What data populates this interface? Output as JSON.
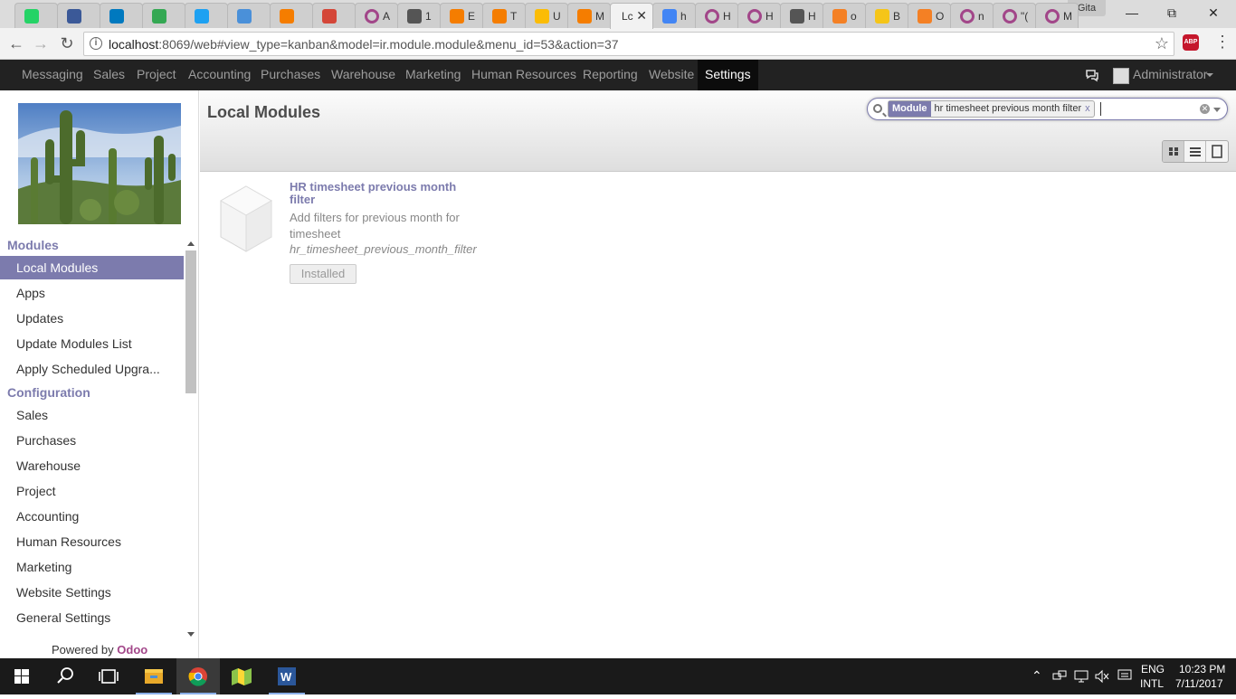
{
  "browser": {
    "tabs": [
      {
        "title": "",
        "icon": "whatsapp-icon",
        "color": "#25d366"
      },
      {
        "title": "",
        "icon": "facebook-icon",
        "color": "#3b5998"
      },
      {
        "title": "",
        "icon": "trello-icon",
        "color": "#0079bf"
      },
      {
        "title": "",
        "icon": "maps-icon",
        "color": "#34a853"
      },
      {
        "title": "",
        "icon": "twitter-icon",
        "color": "#1da1f2"
      },
      {
        "title": "",
        "icon": "stack-icon",
        "color": "#4a90d9"
      },
      {
        "title": "",
        "icon": "blogger-icon",
        "color": "#f57d00"
      },
      {
        "title": "",
        "icon": "gmail-icon",
        "color": "#d44638"
      },
      {
        "title": "A",
        "icon": "odoo-icon",
        "color": "#a24689"
      },
      {
        "title": "1",
        "icon": "hash-icon",
        "color": "#555555"
      },
      {
        "title": "E",
        "icon": "blogger-icon",
        "color": "#f57d00"
      },
      {
        "title": "T",
        "icon": "blogger-icon",
        "color": "#f57d00"
      },
      {
        "title": "U",
        "icon": "drive-icon",
        "color": "#fbbc05"
      },
      {
        "title": "M",
        "icon": "blogger-icon",
        "color": "#f57d00"
      },
      {
        "title": "Lc",
        "icon": "",
        "color": "#f2f2f2",
        "active": true
      },
      {
        "title": "h",
        "icon": "google-icon",
        "color": "#4285f4"
      },
      {
        "title": "H",
        "icon": "odoo-icon",
        "color": "#a24689"
      },
      {
        "title": "H",
        "icon": "odoo-icon",
        "color": "#a24689"
      },
      {
        "title": "H",
        "icon": "book-icon",
        "color": "#555555"
      },
      {
        "title": "o",
        "icon": "stackoverflow-icon",
        "color": "#f48024"
      },
      {
        "title": "B",
        "icon": "lp-icon",
        "color": "#f5c518"
      },
      {
        "title": "O",
        "icon": "stackoverflow-icon",
        "color": "#f48024"
      },
      {
        "title": "n",
        "icon": "odoo-icon",
        "color": "#a24689"
      },
      {
        "title": "\"(",
        "icon": "odoo-icon",
        "color": "#a24689"
      },
      {
        "title": "M",
        "icon": "odoo-icon",
        "color": "#a24689"
      }
    ],
    "profile": "Gita",
    "url_host": "localhost",
    "url_rest": ":8069/web#view_type=kanban&model=ir.module.module&menu_id=53&action=37",
    "abp_label": "ABP"
  },
  "topmenu": {
    "items": [
      "Messaging",
      "Sales",
      "Project",
      "Accounting",
      "Purchases",
      "Warehouse",
      "Marketing",
      "Human Resources",
      "Reporting",
      "Website",
      "Settings"
    ],
    "active": "Settings",
    "user": "Administrator"
  },
  "sidebar": {
    "sections": [
      {
        "title": "Modules",
        "items": [
          "Local Modules",
          "Apps",
          "Updates",
          "Update Modules List",
          "Apply Scheduled Upgra..."
        ]
      },
      {
        "title": "Configuration",
        "items": [
          "Sales",
          "Purchases",
          "Warehouse",
          "Project",
          "Accounting",
          "Human Resources",
          "Marketing",
          "Website Settings",
          "General Settings"
        ]
      }
    ],
    "active_item": "Local Modules",
    "powered_prefix": "Powered by",
    "powered_brand": "Odoo"
  },
  "main": {
    "title": "Local Modules",
    "search": {
      "facet_category": "Module",
      "facet_value": "hr timesheet previous month filter",
      "facet_remove": "x"
    },
    "views": [
      "kanban",
      "list",
      "form"
    ],
    "active_view": "kanban",
    "module": {
      "name": "HR timesheet previous month filter",
      "summary": "Add filters for previous month for timesheet",
      "technical_name": "hr_timesheet_previous_month_filter",
      "state_button": "Installed"
    }
  },
  "taskbar": {
    "apps": [
      "start",
      "search",
      "task-view",
      "file-explorer",
      "chrome",
      "maps",
      "word"
    ],
    "lang": "ENG",
    "layout": "INTL",
    "time": "10:23 PM",
    "date": "7/11/2017"
  }
}
